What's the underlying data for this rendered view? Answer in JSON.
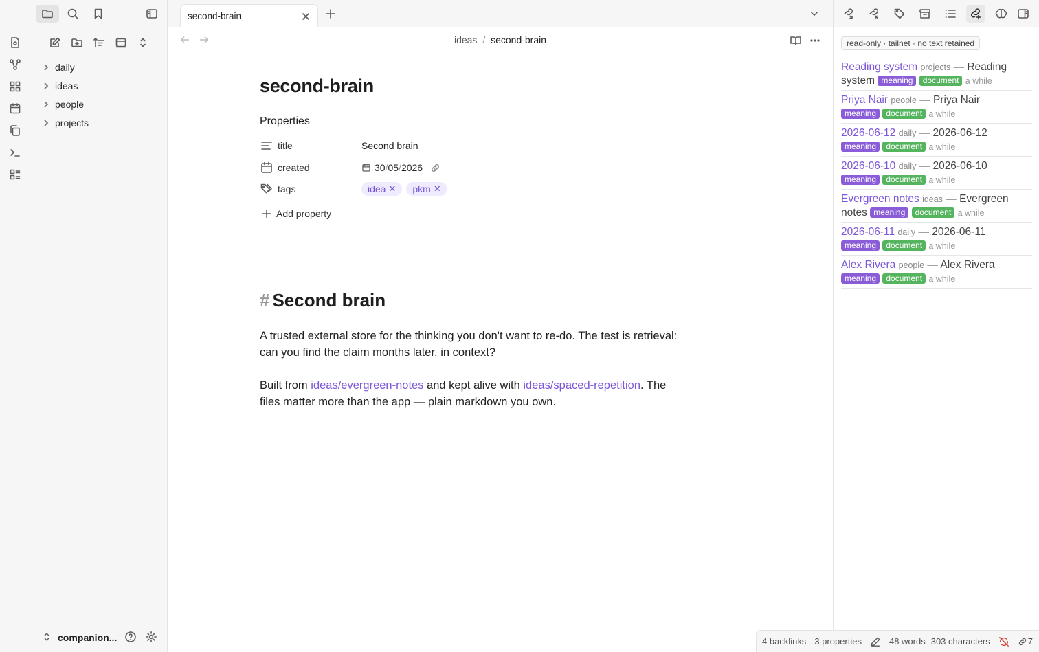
{
  "tab": {
    "title": "second-brain"
  },
  "breadcrumb": {
    "parent": "ideas",
    "separator": "/",
    "current": "second-brain"
  },
  "sidebar": {
    "folders": [
      {
        "label": "daily"
      },
      {
        "label": "ideas"
      },
      {
        "label": "people"
      },
      {
        "label": "projects"
      }
    ],
    "vault_name": "companion..."
  },
  "note": {
    "title": "second-brain",
    "properties_label": "Properties",
    "properties": {
      "title": {
        "key": "title",
        "value": "Second brain"
      },
      "created": {
        "key": "created",
        "day": "30",
        "month": "05",
        "year": "2026",
        "sep": "/"
      },
      "tags": {
        "key": "tags",
        "values": [
          "idea",
          "pkm"
        ],
        "remove": "✕"
      }
    },
    "add_property": "Add property",
    "heading_hash": "#",
    "heading": "Second brain",
    "para1": "A trusted external store for the thinking you don't want to re-do. The test is retrieval: can you find the claim months later, in context?",
    "para2": {
      "pre": "Built from ",
      "link1": "ideas/evergreen-notes",
      "mid": " and kept alive with ",
      "link2": "ideas/spaced-repetition",
      "post": ". The files matter more than the app — plain markdown you own."
    }
  },
  "right": {
    "status_pill": "read-only · tailnet · no text retained",
    "items": [
      {
        "title": "Reading system",
        "folder": "projects",
        "desc": "— Reading system",
        "badges": [
          "meaning",
          "document"
        ],
        "when": "a while"
      },
      {
        "title": "Priya Nair",
        "folder": "people",
        "desc": "— Priya Nair",
        "badges": [
          "meaning",
          "document"
        ],
        "when": "a while"
      },
      {
        "title": "2026-06-12",
        "folder": "daily",
        "desc": "— 2026-06-12",
        "badges": [
          "meaning",
          "document"
        ],
        "when": "a while"
      },
      {
        "title": "2026-06-10",
        "folder": "daily",
        "desc": "— 2026-06-10",
        "badges": [
          "meaning",
          "document"
        ],
        "when": "a while"
      },
      {
        "title": "Evergreen notes",
        "folder": "ideas",
        "desc": "— Evergreen notes",
        "badges": [
          "meaning",
          "document"
        ],
        "when": "a while"
      },
      {
        "title": "2026-06-11",
        "folder": "daily",
        "desc": "— 2026-06-11",
        "badges": [
          "meaning",
          "document"
        ],
        "when": "a while"
      },
      {
        "title": "Alex Rivera",
        "folder": "people",
        "desc": "— Alex Rivera",
        "badges": [
          "meaning",
          "document"
        ],
        "when": "a while"
      }
    ]
  },
  "status": {
    "backlinks": "4 backlinks",
    "properties": "3 properties",
    "words": "48 words",
    "characters": "303 characters",
    "sync_count": "7"
  },
  "colors": {
    "accent": "#7c57d8",
    "badge_meaning": "#8a5cd8",
    "badge_document": "#55b45e"
  }
}
